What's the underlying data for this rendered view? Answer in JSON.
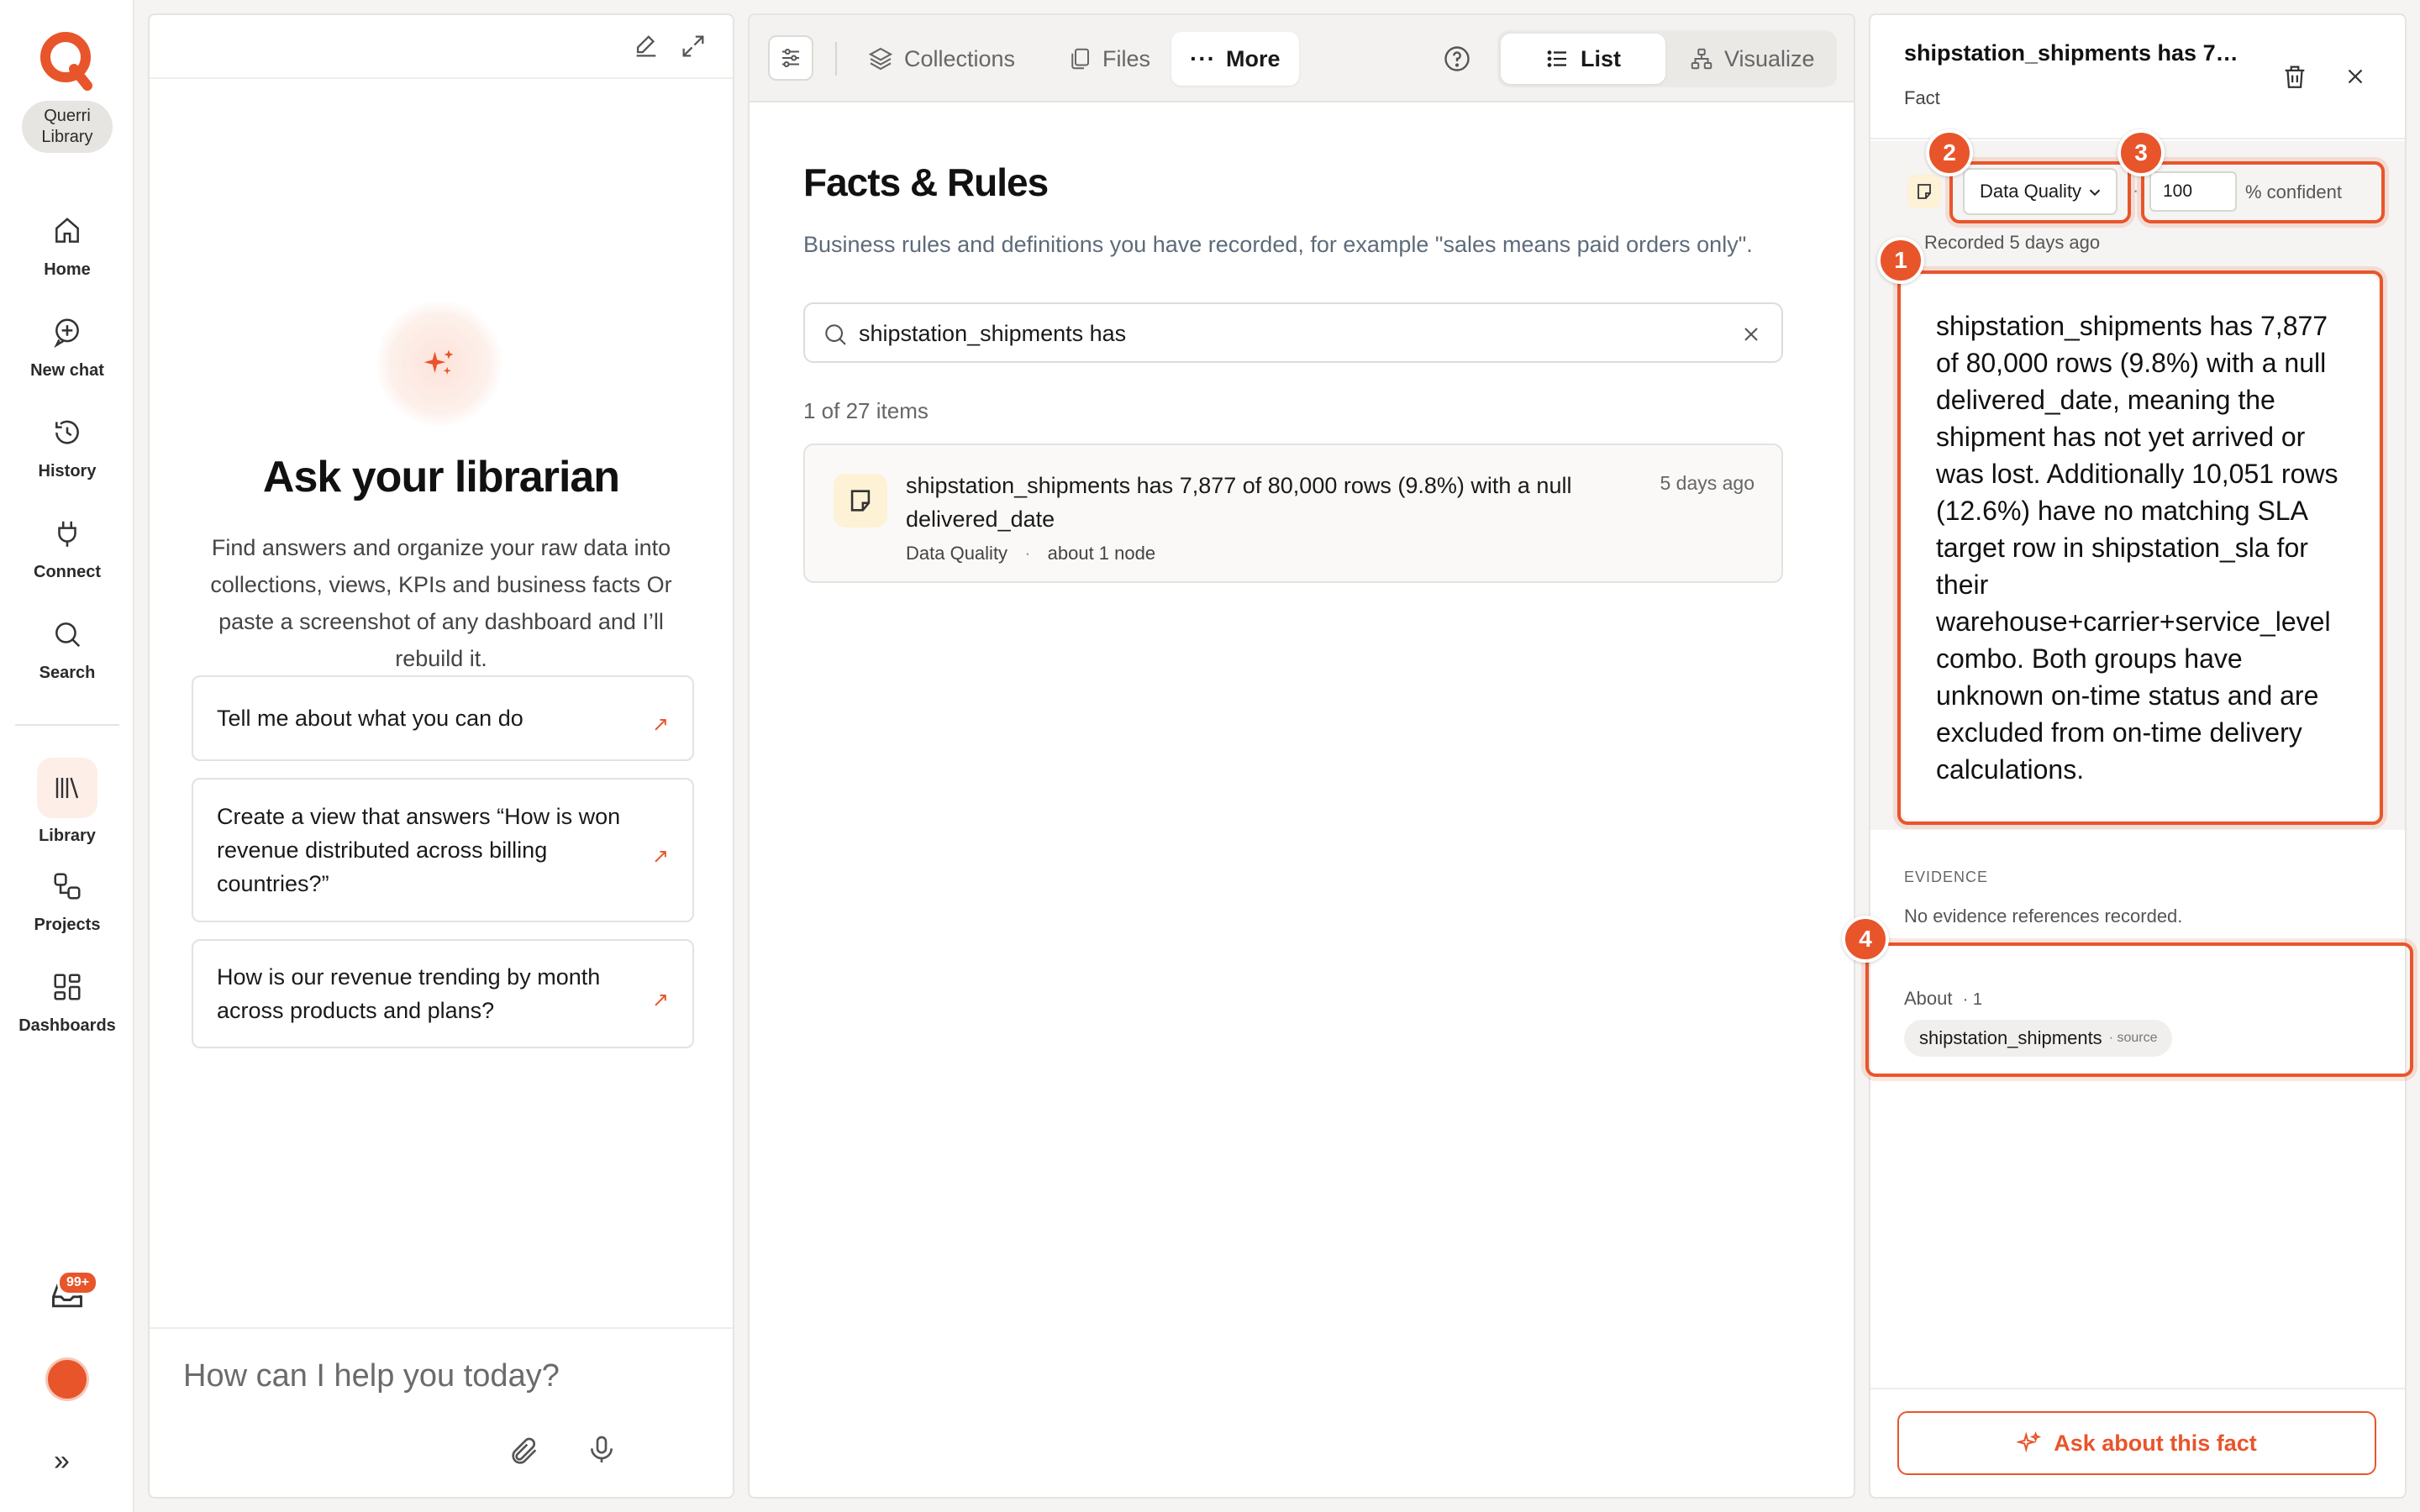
{
  "nav": {
    "brand": "Querri Library",
    "items": [
      {
        "label": "Home"
      },
      {
        "label": "New chat"
      },
      {
        "label": "History"
      },
      {
        "label": "Connect"
      },
      {
        "label": "Search"
      },
      {
        "label": "Library"
      },
      {
        "label": "Projects"
      },
      {
        "label": "Dashboards"
      }
    ],
    "inbox_badge": "99+",
    "accent": "#e8552b"
  },
  "chat": {
    "title": "Ask your librarian",
    "description": "Find answers and organize your raw data into collections, views, KPIs and business facts Or paste a screenshot of any dashboard and I’ll rebuild it.",
    "suggestions": [
      {
        "text": "Tell me about what you can do"
      },
      {
        "text": "Create a view that answers “How is won revenue distributed across billing countries?”"
      },
      {
        "text": "How is our revenue trending by month across products and plans?"
      }
    ],
    "input_placeholder": "How can I help you today?"
  },
  "toolbar": {
    "collections": "Collections",
    "files": "Files",
    "more": "More",
    "list": "List",
    "visualize": "Visualize"
  },
  "main": {
    "title": "Facts & Rules",
    "subtitle": "Business rules and definitions you have recorded, for example \"sales means paid orders only\".",
    "search_value": "shipstation_shipments has",
    "count": "1 of 27 items",
    "facts": [
      {
        "text": "shipstation_shipments has 7,877 of 80,000 rows (9.8%) with a null delivered_date",
        "category": "Data Quality",
        "about": "about 1 node",
        "time": "5 days ago"
      }
    ]
  },
  "detail": {
    "title": "shipstation_shipments has 7…",
    "type": "Fact",
    "category": "Data Quality",
    "confidence": "100",
    "confidence_label": "% confident",
    "recorded": "Recorded 5 days ago",
    "body": "shipstation_shipments has 7,877 of 80,000 rows (9.8%) with a null delivered_date, meaning the shipment has not yet arrived or was lost. Additionally 10,051 rows (12.6%) have no matching SLA target row in shipstation_sla for their warehouse+carrier+service_level combo. Both groups have unknown on-time status and are excluded from on-time delivery calculations.",
    "evidence_label": "EVIDENCE",
    "evidence_text": "No evidence references recorded.",
    "about_label": "About",
    "about_count": "· 1",
    "about_chip": "shipstation_shipments",
    "about_chip_kind": "· source",
    "ask_button": "Ask about this fact",
    "markers": [
      "1",
      "2",
      "3",
      "4"
    ]
  }
}
